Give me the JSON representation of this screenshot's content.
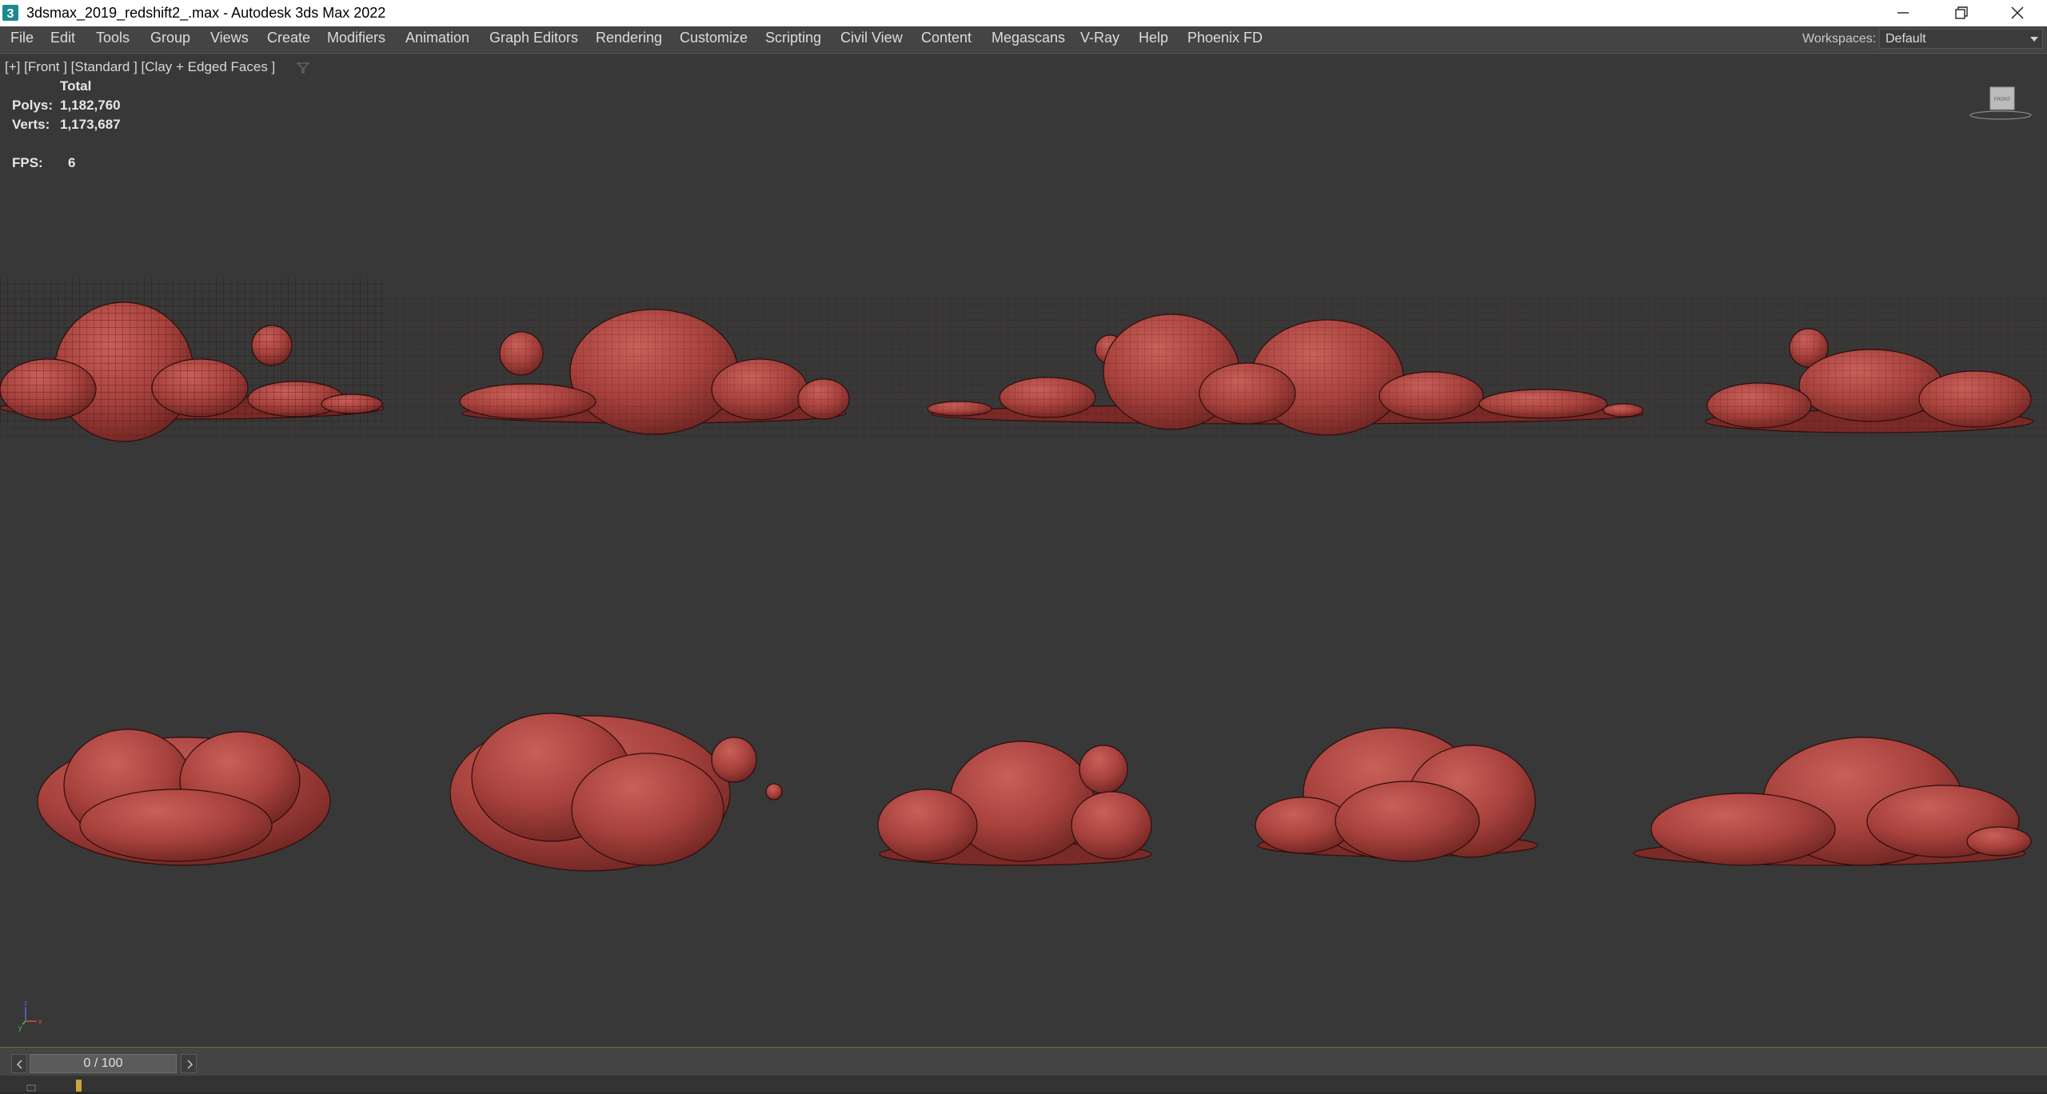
{
  "window": {
    "title": "3dsmax_2019_redshift2_.max - Autodesk 3ds Max 2022"
  },
  "menubar": {
    "items": [
      "File",
      "Edit",
      "Tools",
      "Group",
      "Views",
      "Create",
      "Modifiers",
      "Animation",
      "Graph Editors",
      "Rendering",
      "Customize",
      "Scripting",
      "Civil View",
      "Content",
      "Megascans",
      "V-Ray",
      "Help",
      "Phoenix FD"
    ],
    "workspaces_label": "Workspaces:",
    "workspaces_value": "Default"
  },
  "viewport": {
    "label": "[+] [Front ] [Standard ] [Clay + Edged Faces ]",
    "stats": {
      "header": "Total",
      "polys_label": "Polys:",
      "polys_value": "1,182,760",
      "verts_label": "Verts:",
      "verts_value": "1,173,687",
      "fps_label": "FPS:",
      "fps_value": "6"
    },
    "viewcube_label": "FRONT",
    "axis_labels": {
      "z": "z",
      "y": "y",
      "x": "x"
    },
    "object_color": "#b34b45"
  },
  "timeslider": {
    "frame_display": "0 / 100",
    "prev_label": "<",
    "next_label": ">"
  }
}
